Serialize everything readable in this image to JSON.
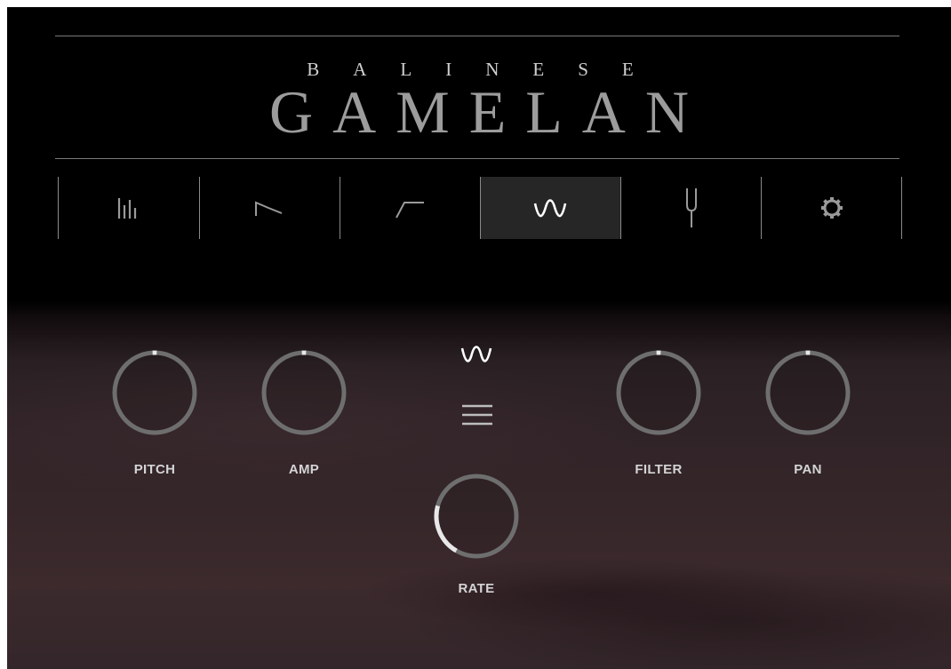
{
  "header": {
    "subtitle": "BALINESE",
    "title": "GAMELAN"
  },
  "tabs": [
    {
      "icon": "mixer-bars-icon",
      "active": false
    },
    {
      "icon": "envelope-decay-icon",
      "active": false
    },
    {
      "icon": "envelope-attack-icon",
      "active": false
    },
    {
      "icon": "lfo-wave-icon",
      "active": true
    },
    {
      "icon": "tuning-fork-icon",
      "active": false
    },
    {
      "icon": "gear-icon",
      "active": false
    }
  ],
  "lfo": {
    "waveform_icon": "sine-wave-icon",
    "menu_icon": "hamburger-menu-icon",
    "knobs": {
      "pitch": {
        "label": "PITCH",
        "value": 0.5
      },
      "amp": {
        "label": "AMP",
        "value": 0.5
      },
      "filter": {
        "label": "FILTER",
        "value": 0.5
      },
      "pan": {
        "label": "PAN",
        "value": 0.5
      },
      "rate": {
        "label": "RATE",
        "value": 0.25
      }
    }
  },
  "colors": {
    "background_top": "#000000",
    "background_bottom": "#3c2a2d",
    "knob_ring": "#6e6e6e",
    "knob_value_arc": "#e8e8e8",
    "active_tab": "#262626",
    "label_text": "#d4d4d4"
  }
}
